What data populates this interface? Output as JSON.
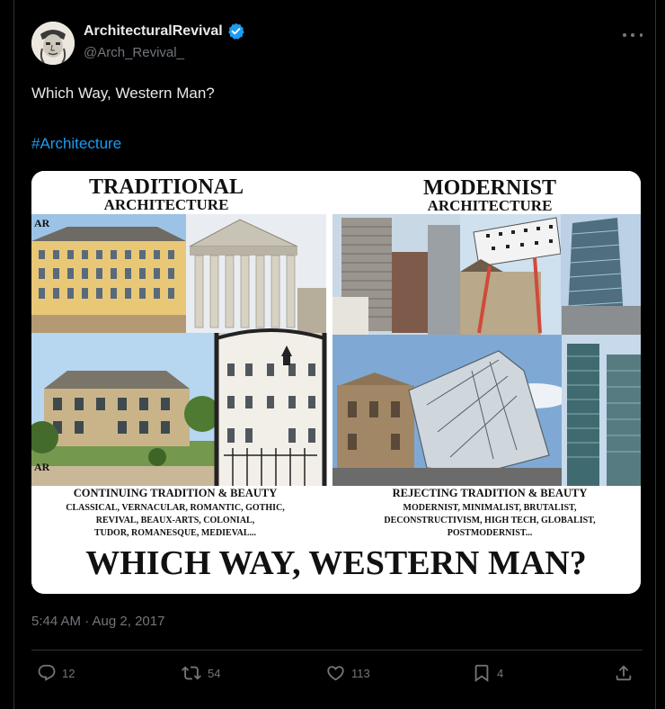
{
  "author": {
    "display_name": "ArchitecturalRevival",
    "handle": "@Arch_Revival_",
    "verified_icon": "verified-badge-icon",
    "avatar_icon": "statue-face-avatar"
  },
  "post": {
    "text": "Which Way, Western Man?",
    "hashtag": "#Architecture",
    "timestamp": "5:44 AM · Aug 2, 2017"
  },
  "image": {
    "left_title_1": "TRADITIONAL",
    "left_title_2": "ARCHITECTURE",
    "right_title_1": "MODERNIST",
    "right_title_2": "ARCHITECTURE",
    "watermark": "AR",
    "left_caption_1": "CONTINUING TRADITION & BEAUTY",
    "left_caption_2": "CLASSICAL, VERNACULAR, ROMANTIC, GOTHIC,",
    "left_caption_3": "REVIVAL, BEAUX-ARTS, COLONIAL,",
    "left_caption_4": "TUDOR, ROMANESQUE, MEDIEVAL...",
    "right_caption_1": "REJECTING TRADITION & BEAUTY",
    "right_caption_2": "MODERNIST, MINIMALIST, BRUTALIST,",
    "right_caption_3": "DECONSTRUCTIVISM, HIGH TECH, GLOBALIST,",
    "right_caption_4": "POSTMODERNIST...",
    "bottom_title": "WHICH WAY, WESTERN MAN?"
  },
  "actions": {
    "replies": "12",
    "reposts": "54",
    "likes": "113",
    "bookmarks": "4"
  },
  "colors": {
    "background": "#000000",
    "text": "#e7e9ea",
    "muted": "#71767b",
    "link": "#1d9bf0",
    "border": "#2f3336"
  }
}
